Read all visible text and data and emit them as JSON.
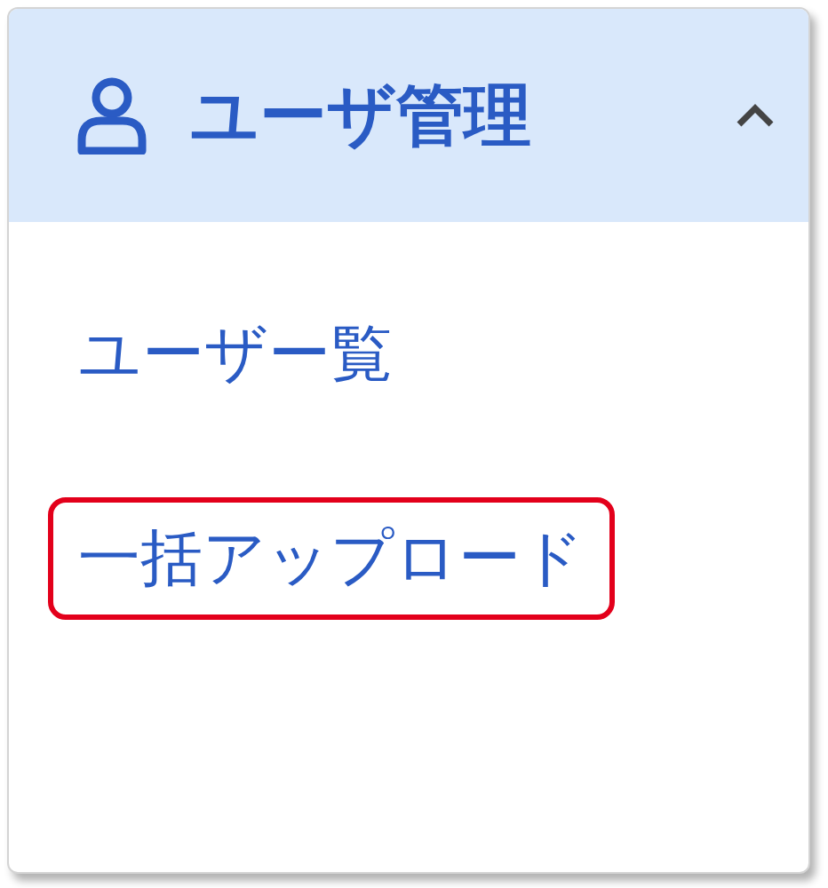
{
  "menu_group": {
    "title": "ユーザ管理",
    "expanded": true
  },
  "items": [
    {
      "label": "ユーザー覧",
      "highlighted": false
    },
    {
      "label": "一括アップロード",
      "highlighted": true
    }
  ]
}
